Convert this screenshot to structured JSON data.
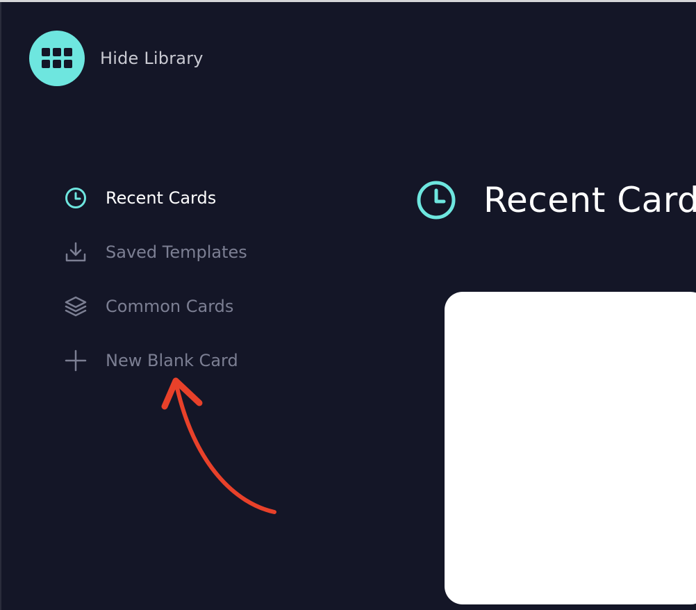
{
  "library_toggle": {
    "label": "Hide Library",
    "icon": "grid-icon",
    "accent_color": "#6ee6df"
  },
  "sidebar": {
    "items": [
      {
        "label": "Recent Cards",
        "icon": "clock-icon",
        "active": true
      },
      {
        "label": "Saved Templates",
        "icon": "download-icon",
        "active": false
      },
      {
        "label": "Common Cards",
        "icon": "layers-icon",
        "active": false
      },
      {
        "label": "New Blank Card",
        "icon": "plus-icon",
        "active": false
      }
    ]
  },
  "main": {
    "title": "Recent Cards",
    "title_icon": "clock-icon"
  },
  "annotation": {
    "arrow_color": "#e8412a",
    "icon": "arrow-annotation-icon"
  },
  "colors": {
    "background": "#141627",
    "accent": "#6ee6df",
    "inactive_text": "#7c7f93",
    "active_text": "#ffffff"
  }
}
